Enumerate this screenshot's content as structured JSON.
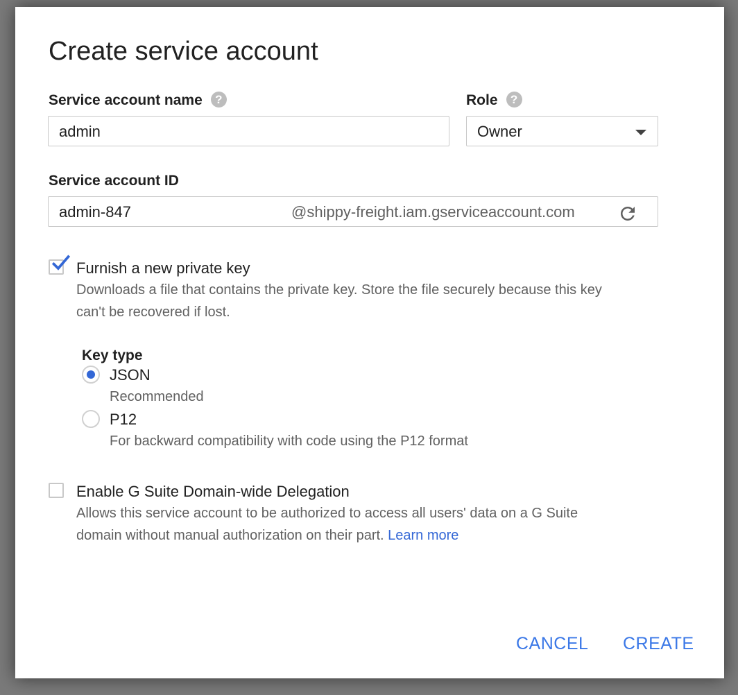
{
  "dialog": {
    "title": "Create service account",
    "name_field": {
      "label": "Service account name",
      "help_icon": "help-icon",
      "value": "admin"
    },
    "role_field": {
      "label": "Role",
      "help_icon": "help-icon",
      "selected": "Owner"
    },
    "id_field": {
      "label": "Service account ID",
      "value": "admin-847",
      "suffix": "@shippy-freight.iam.gserviceaccount.com",
      "refresh_icon": "refresh-icon"
    },
    "private_key": {
      "checked": true,
      "label": "Furnish a new private key",
      "description_line1": "Downloads a file that contains the private key. Store the file securely because this key",
      "description_line2": "can't be recovered if lost."
    },
    "key_type": {
      "label": "Key type",
      "options": [
        {
          "label": "JSON",
          "hint": "Recommended",
          "selected": true
        },
        {
          "label": "P12",
          "hint": "For backward compatibility with code using the P12 format",
          "selected": false
        }
      ]
    },
    "delegation": {
      "checked": false,
      "label": "Enable G Suite Domain-wide Delegation",
      "description_line1": "Allows this service account to be authorized to access all users' data on a G Suite",
      "description_line2": "domain without manual authorization on their part.",
      "learn_more": "Learn more"
    },
    "buttons": {
      "cancel": "CANCEL",
      "create": "CREATE"
    },
    "colors": {
      "accent": "#3367d6",
      "button_text": "#3b78e7",
      "help_icon": "#bdbdbd"
    }
  }
}
